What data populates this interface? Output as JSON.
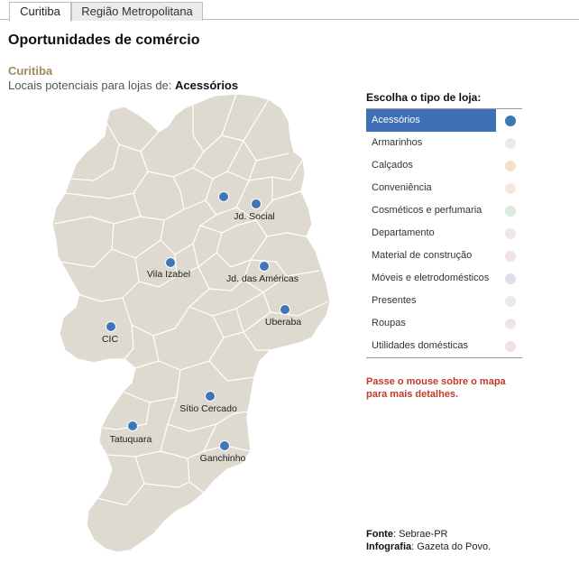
{
  "tabs": [
    {
      "label": "Curitiba",
      "active": true
    },
    {
      "label": "Região Metropolitana",
      "active": false
    }
  ],
  "page_title": "Oportunidades de comércio",
  "region_title": "Curitiba",
  "subtitle_prefix": "Locais potenciais para lojas de: ",
  "subtitle_value": "Acessórios",
  "map": {
    "fill_color": "#dedad0",
    "border_color": "#ffffff",
    "marker_color": "#3e76b8",
    "locations": [
      {
        "label": "",
        "icon": "location-marker"
      },
      {
        "label": "Jd. Social",
        "icon": "location-marker"
      },
      {
        "label": "Vila Izabel",
        "icon": "location-marker"
      },
      {
        "label": "Jd. das Américas",
        "icon": "location-marker"
      },
      {
        "label": "Uberaba",
        "icon": "location-marker"
      },
      {
        "label": "CIC",
        "icon": "location-marker"
      },
      {
        "label": "Sítio Cercado",
        "icon": "location-marker"
      },
      {
        "label": "Tatuquara",
        "icon": "location-marker"
      },
      {
        "label": "Ganchinho",
        "icon": "location-marker"
      }
    ]
  },
  "chooser": {
    "title": "Escolha o tipo de loja:",
    "items": [
      {
        "label": "Acessórios",
        "color": "#3e76b8",
        "selected": true
      },
      {
        "label": "Armarinhos",
        "color": "#e8e8f0",
        "selected": false
      },
      {
        "label": "Calçados",
        "color": "#f6e0c8",
        "selected": false
      },
      {
        "label": "Conveniência",
        "color": "#f6e6e0",
        "selected": false
      },
      {
        "label": "Cosméticos e perfumaria",
        "color": "#d9ebd9",
        "selected": false
      },
      {
        "label": "Departamento",
        "color": "#efe6e6",
        "selected": false
      },
      {
        "label": "Material de construção",
        "color": "#f4e3e3",
        "selected": false
      },
      {
        "label": "Móveis e eletrodomésticos",
        "color": "#e2dceb",
        "selected": false
      },
      {
        "label": "Presentes",
        "color": "#ebebeb",
        "selected": false
      },
      {
        "label": "Roupas",
        "color": "#ede6e4",
        "selected": false
      },
      {
        "label": "Utilidades domésticas",
        "color": "#eedfe9",
        "selected": false
      }
    ]
  },
  "hint": "Passe o mouse sobre o mapa para mais detalhes.",
  "credits": {
    "source_label": "Fonte",
    "source_value": ": Sebrae-PR",
    "graphic_label": "Infografia",
    "graphic_value": ": Gazeta do Povo."
  }
}
